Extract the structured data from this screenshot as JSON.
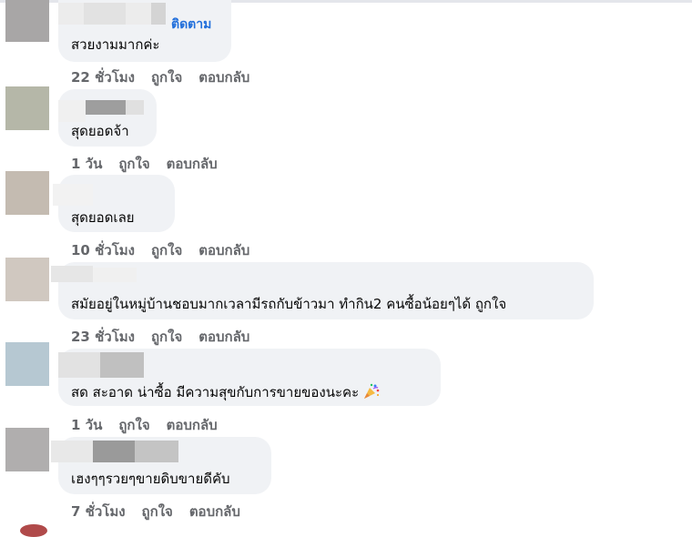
{
  "comments": [
    {
      "text": "สวยงามมากค่ะ",
      "time": "22 ชั่วโมง",
      "follow": "ติดตาม"
    },
    {
      "text": "สุดยอดจ้า",
      "time": "1 วัน"
    },
    {
      "text": "สุดยอดเลย",
      "time": "10 ชั่วโมง"
    },
    {
      "text": "สมัยอยู่ในหมู่บ้านชอบมากเวลามีรถกับข้าวมา ทำกิน2 คนซื้อน้อยๆได้ ถูกใจ",
      "time": "23 ชั่วโมง"
    },
    {
      "text": "สด สะอาด น่าซื้อ มีความสุขกับการขายของนะคะ",
      "time": "1 วัน",
      "emoji": "party-popper-icon"
    },
    {
      "text": "เฮงๆๆรวยๆขายดิบขายดีคับ",
      "time": "7 ชั่วโมง"
    }
  ],
  "labels": {
    "like": "ถูกใจ",
    "reply": "ตอบกลับ"
  },
  "colors": {
    "bubble": "#f0f2f5",
    "follow_link": "#216fdb",
    "meta_text": "#65676b"
  }
}
